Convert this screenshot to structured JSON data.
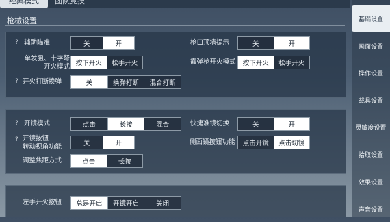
{
  "tabs": [
    {
      "label": "经典模式",
      "active": true
    },
    {
      "label": "团队竞技",
      "active": false
    }
  ],
  "section_title": "枪械设置",
  "panel1": {
    "aim_assist": {
      "label": "辅助瞄准",
      "options": [
        "关",
        "开"
      ],
      "selected": 1
    },
    "muzzle_hint": {
      "label": "枪口顶墙提示",
      "options": [
        "关",
        "开"
      ],
      "selected": 1
    },
    "single_fire": {
      "label": "单发狙、十字弩\n开火模式",
      "options": [
        "按下开火",
        "松手开火"
      ],
      "selected": 0
    },
    "shotgun_fire": {
      "label": "霰弹枪开火模式",
      "options": [
        "按下开火",
        "松手开火"
      ],
      "selected": 0
    },
    "reload_interrupt": {
      "label": "开火打断换弹",
      "options": [
        "关",
        "换弹打断",
        "混合打断"
      ],
      "selected": 0
    }
  },
  "panel2": {
    "scope_mode": {
      "label": "开镜模式",
      "options": [
        "点击",
        "长按",
        "混合"
      ],
      "selected": 1
    },
    "quick_scope": {
      "label": "快捷准镜切换",
      "options": [
        "关",
        "开"
      ],
      "selected": 1
    },
    "scope_button": {
      "label": "开镜按钮\n转动视角功能",
      "options": [
        "关",
        "开"
      ],
      "selected": 1
    },
    "side_scope": {
      "label": "侧面镜按钮功能",
      "options": [
        "点击开镜",
        "点击切镜"
      ],
      "selected": 1
    },
    "focus_mode": {
      "label": "调整焦距方式",
      "options": [
        "点击",
        "长按"
      ],
      "selected": 0
    }
  },
  "panel3": {
    "left_fire": {
      "label": "左手开火按钮",
      "options": [
        "总是开启",
        "开镜开启",
        "关闭"
      ],
      "selected": 0
    }
  },
  "help_mark": "?",
  "sidebar": [
    "基础设置",
    "画面设置",
    "操作设置",
    "载具设置",
    "灵敏度设置",
    "拾取设置",
    "效果设置",
    "声音设置"
  ],
  "sidebar_active": 0
}
